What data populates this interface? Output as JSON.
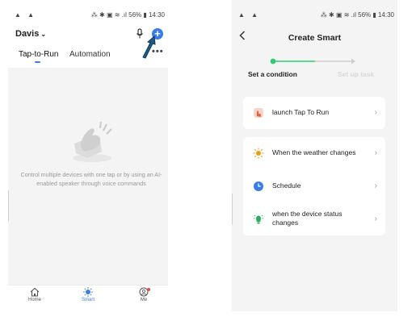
{
  "left_screen": {
    "status": {
      "left_icons": "▲ ▲",
      "right": "⁂ ✱ ▣ ≋ .ıl 56% ▮ 14:30"
    },
    "home_name": "Davis",
    "tabs": [
      "Tap-to-Run",
      "Automation"
    ],
    "more": "•••",
    "empty_message": "Control multiple devices with one tap or by using an AI-enabled speaker through voice commands",
    "nav": {
      "home": "Home",
      "smart": "Smart",
      "me": "Me"
    }
  },
  "right_screen": {
    "status": {
      "left_icons": "▲ ▲",
      "right": "⁂ ✱ ▣ ≋ .ıl 56% ▮ 14:30"
    },
    "title": "Create Smart",
    "steps": [
      "Set a condition",
      "Set up task"
    ],
    "cards": [
      {
        "label": "launch Tap To Run",
        "icon": "hand-tap-icon"
      },
      {
        "label": "When the weather changes",
        "icon": "sun-icon"
      },
      {
        "label": "Schedule",
        "icon": "clock-icon"
      },
      {
        "label": "when the device status changes",
        "icon": "device-icon"
      }
    ]
  },
  "colors": {
    "accent": "#3b7de8",
    "step_active": "#2ecc71",
    "orange": "#f39c12",
    "green": "#27ae60"
  }
}
